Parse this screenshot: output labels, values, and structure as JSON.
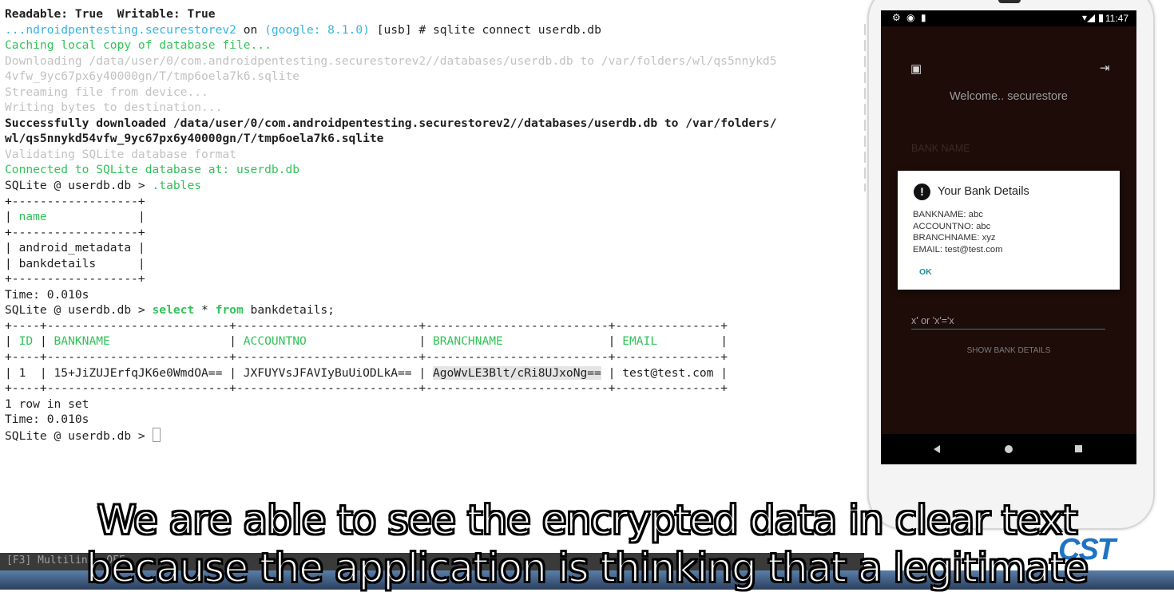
{
  "terminal": {
    "lines": [
      "Readable: True  Writable: True",
      "...ndroidpentesting.securestorev2 on (google: 8.1.0) [usb] # sqlite connect userdb.db",
      "Caching local copy of database file...",
      "Downloading /data/user/0/com.androidpentesting.securestorev2//databases/userdb.db to /var/folders/wl/qs5nnykd5",
      "4vfw_9yc67px6y40000gn/T/tmp6oela7k6.sqlite",
      "Streaming file from device...",
      "Writing bytes to destination...",
      "Successfully downloaded /data/user/0/com.androidpentesting.securestorev2//databases/userdb.db to /var/folders/",
      "wl/qs5nnykd54vfw_9yc67px6y40000gn/T/tmp6oela7k6.sqlite",
      "Validating SQLite database format",
      "Connected to SQLite database at: userdb.db",
      "SQLite @ userdb.db > .tables",
      "+------------------+",
      "| name             |",
      "+------------------+",
      "| android_metadata |",
      "| bankdetails      |",
      "+------------------+",
      "Time: 0.010s",
      "SQLite @ userdb.db > select * from bankdetails;",
      "+----+--------------------------+--------------------------+--------------------------+---------------+",
      "| ID | BANKNAME                 | ACCOUNTNO                | BRANCHNAME               | EMAIL         |",
      "+----+--------------------------+--------------------------+--------------------------+---------------+",
      "| 1  | 15+JiZUJErfqJK6e0WmdOA== | JXFUYVsJFAVIyBuUiODLkA== | AgoWvLE3Blt/cRi8UJxoNg== | test@test.com |",
      "+----+--------------------------+--------------------------+--------------------------+---------------+",
      "1 row in set",
      "Time: 0.010s",
      "SQLite @ userdb.db > "
    ],
    "status_bar": "[F3] Multiline: OFF",
    "colors": {
      "green": "#33c25a",
      "cyan": "#33b5e0",
      "grey": "#c2c2c2",
      "text": "#1f1f1f"
    }
  },
  "phone": {
    "status": {
      "time": "11:47"
    },
    "welcome": "Welcome.. securestore",
    "bank_name_hint": "BANK NAME",
    "dialog": {
      "title": "Your Bank Details",
      "lines": [
        "BANKNAME: abc",
        "ACCOUNTNO: abc",
        "BRANCHNAME: xyz",
        "EMAIL: test@test.com"
      ],
      "ok_label": "OK"
    },
    "query_value": "x' or 'x'='x",
    "show_button": "SHOW BANK DETAILS",
    "icons": [
      "settings-icon",
      "circle-icon",
      "sd-card-icon",
      "wifi-icon",
      "signal-icon",
      "battery-icon",
      "profile-icon",
      "logout-icon"
    ]
  },
  "watermark": "CST",
  "subtitle": [
    "We are able to see the encrypted data in clear text",
    "because the application is thinking that a legitimate"
  ]
}
